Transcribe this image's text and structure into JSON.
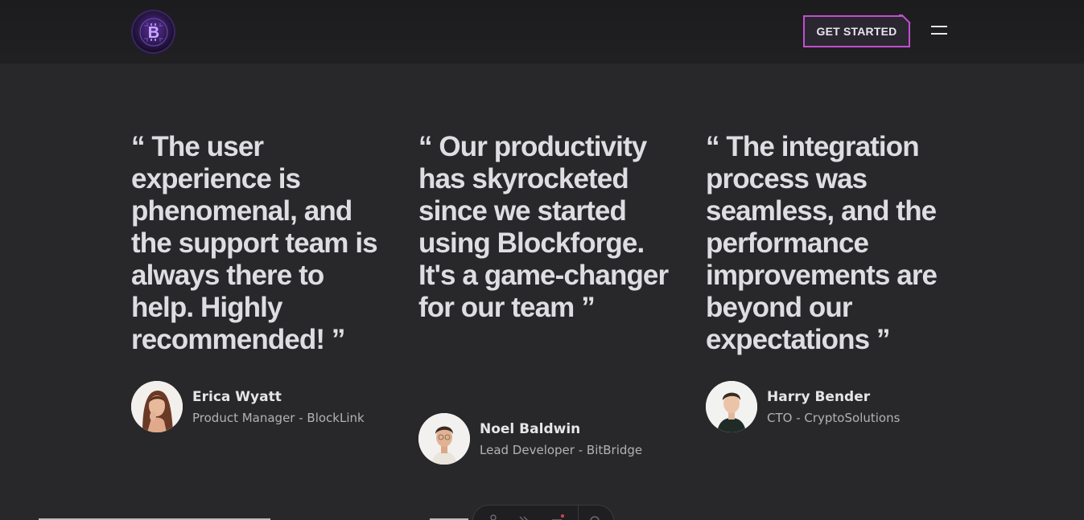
{
  "header": {
    "logo_icon": "bitcoin-circuit-logo-icon",
    "cta_label": "GET STARTED",
    "menu_icon": "hamburger-menu-icon",
    "accent_color": "#c04fd0"
  },
  "testimonials": [
    {
      "quote": "“ The user experience is phenomenal, and the support team is always there to help. Highly recommended! ”",
      "name": "Erica Wyatt",
      "role": "Product Manager - BlockLink",
      "avatar_icon": "woman-portrait-avatar"
    },
    {
      "quote": "“ Our productivity has skyrocketed since we started using Blockforge. It's a game-changer for our team ”",
      "name": "Noel Baldwin",
      "role": "Lead Developer - BitBridge",
      "avatar_icon": "man-portrait-avatar"
    },
    {
      "quote": "“ The integration process was seamless, and the performance improvements are beyond our expectations ”",
      "name": "Harry Bender",
      "role": "CTO - CryptoSolutions",
      "avatar_icon": "man-portrait-avatar"
    }
  ]
}
